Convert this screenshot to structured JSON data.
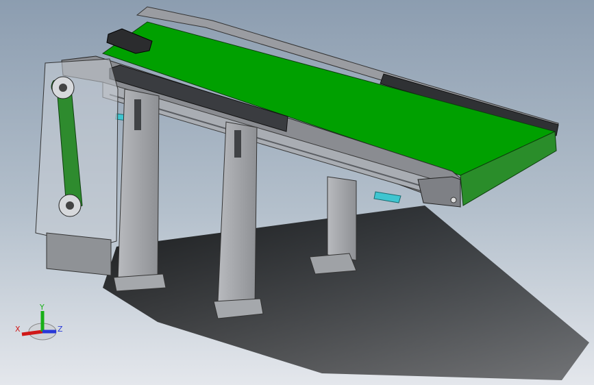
{
  "viewport": {
    "background_top": "#8c9db0",
    "background_bottom": "#e4e7ec"
  },
  "model": {
    "description_icon": "belt-conveyor-3d-model",
    "belt_color": "#00a000",
    "frame_color": "#7b7d82",
    "dark_part_color": "#2d2f32",
    "accent_color": "#3fc5d0"
  },
  "triad": {
    "x_label": "X",
    "y_label": "Y",
    "z_label": "Z",
    "x_color": "#d01818",
    "y_color": "#18b018",
    "z_color": "#2838d8"
  }
}
